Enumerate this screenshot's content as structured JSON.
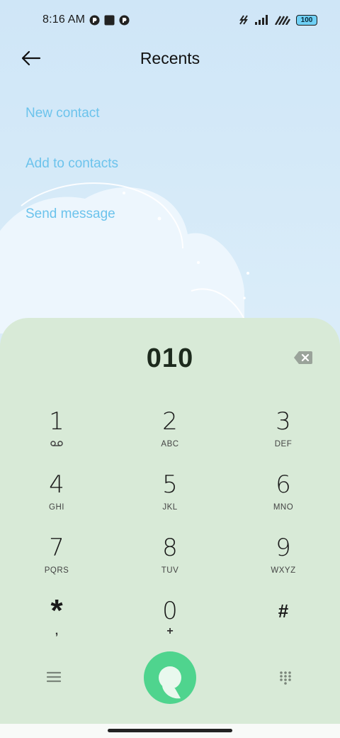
{
  "status_bar": {
    "time": "8:16 AM",
    "left_icons": [
      "app-notification-icon",
      "stop-square-icon",
      "app-notification-icon"
    ],
    "right_icons": [
      "data-icon",
      "signal-icon",
      "wifi-icon"
    ],
    "battery": "100"
  },
  "header": {
    "title": "Recents",
    "back_icon": "arrow-left-icon"
  },
  "actions": [
    {
      "label": "New contact"
    },
    {
      "label": "Add to contacts"
    },
    {
      "label": "Send message"
    }
  ],
  "dialer": {
    "number": "010",
    "backspace_icon": "backspace-icon",
    "keys": [
      {
        "digit": "1",
        "letters": "",
        "sub_icon": "voicemail-icon"
      },
      {
        "digit": "2",
        "letters": "ABC"
      },
      {
        "digit": "3",
        "letters": "DEF"
      },
      {
        "digit": "4",
        "letters": "GHI"
      },
      {
        "digit": "5",
        "letters": "JKL"
      },
      {
        "digit": "6",
        "letters": "MNO"
      },
      {
        "digit": "7",
        "letters": "PQRS"
      },
      {
        "digit": "8",
        "letters": "TUV"
      },
      {
        "digit": "9",
        "letters": "WXYZ"
      },
      {
        "digit": "*",
        "letters": ","
      },
      {
        "digit": "0",
        "letters": "+"
      },
      {
        "digit": "#",
        "letters": ""
      }
    ],
    "menu_icon": "hamburger-menu-icon",
    "call_icon": "call-icon",
    "keypad_toggle_icon": "dialpad-icon"
  },
  "colors": {
    "accent_link": "#6cc3ec",
    "dialer_bg": "#d8ead7",
    "call_button": "#4fd48e"
  }
}
